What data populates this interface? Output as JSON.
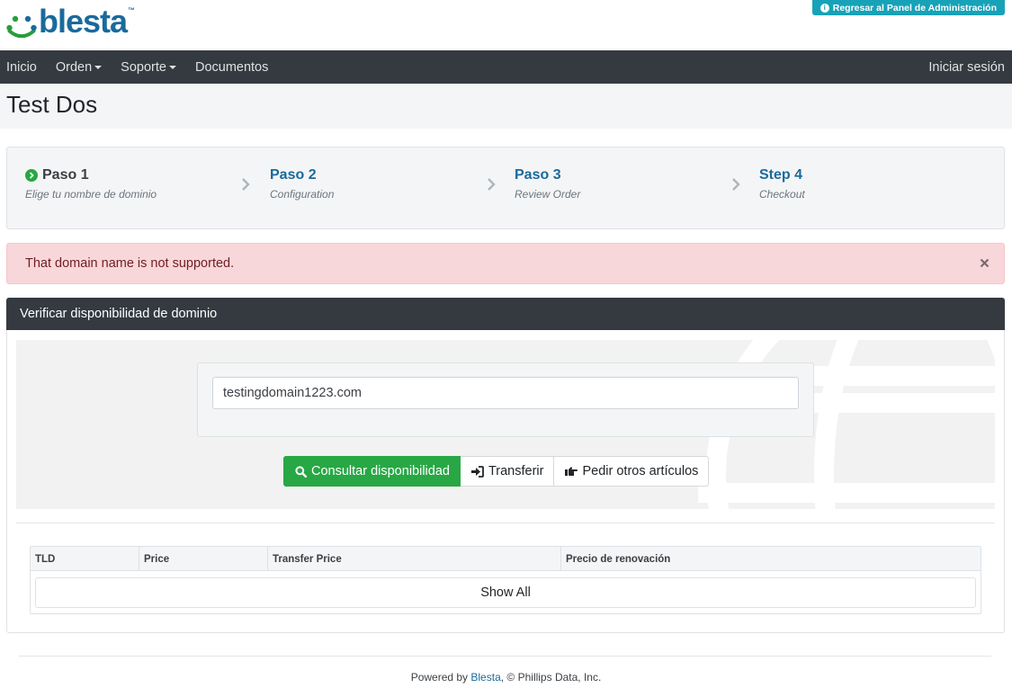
{
  "header": {
    "logo_text": "blesta",
    "logo_tm": "™",
    "admin_button": "Regresar al Panel de Administración"
  },
  "nav": {
    "items": [
      {
        "label": "Inicio",
        "dropdown": false
      },
      {
        "label": "Orden",
        "dropdown": true
      },
      {
        "label": "Soporte",
        "dropdown": true
      },
      {
        "label": "Documentos",
        "dropdown": false
      }
    ],
    "login": "Iniciar sesión"
  },
  "page": {
    "title": "Test Dos"
  },
  "steps": [
    {
      "title": "Paso 1",
      "subtitle": "Elige tu nombre de dominio",
      "active": true
    },
    {
      "title": "Paso 2",
      "subtitle": "Configuration",
      "active": false
    },
    {
      "title": "Paso 3",
      "subtitle": "Review Order",
      "active": false
    },
    {
      "title": "Step 4",
      "subtitle": "Checkout",
      "active": false
    }
  ],
  "alert": {
    "message": "That domain name is not supported."
  },
  "domain_panel": {
    "heading": "Verificar disponibilidad de dominio",
    "input_value": "testingdomain1223.com",
    "buttons": {
      "check": "Consultar disponibilidad",
      "transfer": "Transferir",
      "other": "Pedir otros artículos"
    },
    "table": {
      "columns": [
        "TLD",
        "Price",
        "Transfer Price",
        "Precio de renovación"
      ],
      "show_all": "Show All"
    }
  },
  "footer": {
    "prefix": "Powered by ",
    "link": "Blesta",
    "suffix": ", © Phillips Data, Inc."
  },
  "colors": {
    "primary": "#1a6a9c",
    "nav": "#343a40",
    "success": "#28a745",
    "info": "#17a2b8",
    "danger_bg": "#f8d7da"
  }
}
